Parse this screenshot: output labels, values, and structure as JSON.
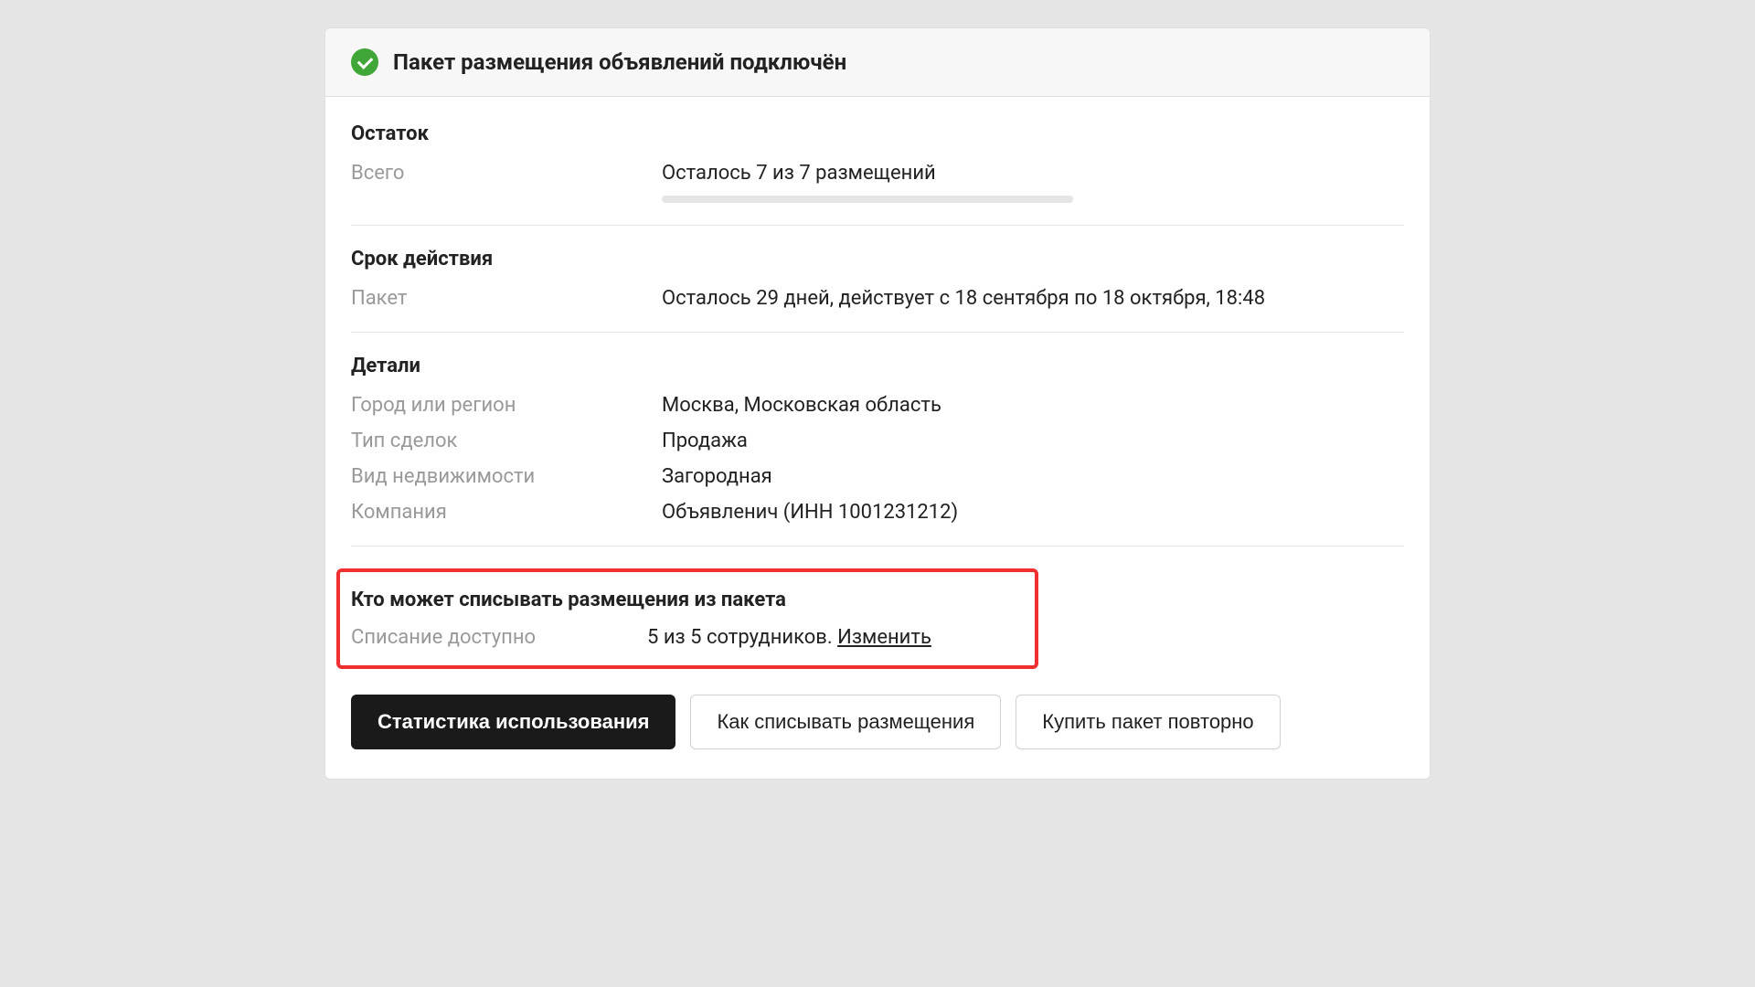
{
  "header": {
    "title": "Пакет размещения объявлений подключён"
  },
  "sections": {
    "balance": {
      "title": "Остаток",
      "total_label": "Всего",
      "total_value": "Осталось 7 из 7 размещений"
    },
    "validity": {
      "title": "Срок действия",
      "package_label": "Пакет",
      "package_value": "Осталось 29 дней, действует с 18 сентября по 18 октября, 18:48"
    },
    "details": {
      "title": "Детали",
      "region_label": "Город или регион",
      "region_value": "Москва, Московская область",
      "deal_type_label": "Тип сделок",
      "deal_type_value": "Продажа",
      "property_type_label": "Вид недвижимости",
      "property_type_value": "Загородная",
      "company_label": "Компания",
      "company_value": "Объявленич (ИНН 1001231212)"
    },
    "access": {
      "title": "Кто может списывать размещения из пакета",
      "access_label": "Списание доступно",
      "access_value": "5 из 5 сотрудников. ",
      "change_link": "Изменить"
    }
  },
  "buttons": {
    "stats": "Статистика использования",
    "howto": "Как списывать размещения",
    "rebuy": "Купить пакет повторно"
  }
}
